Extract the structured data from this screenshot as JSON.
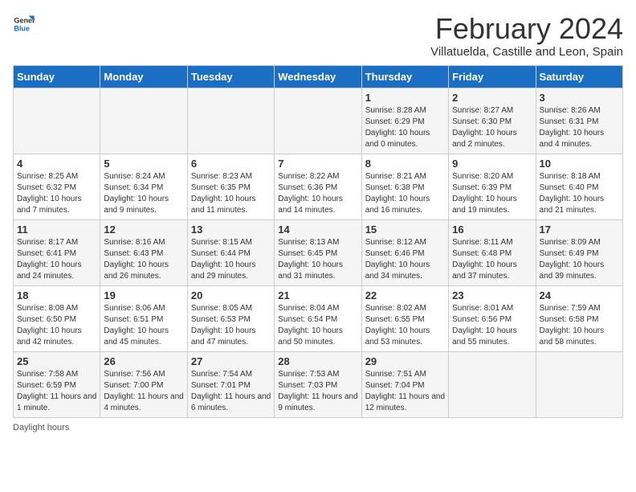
{
  "logo": {
    "general": "General",
    "blue": "Blue"
  },
  "title": "February 2024",
  "subtitle": "Villatuelda, Castille and Leon, Spain",
  "headers": [
    "Sunday",
    "Monday",
    "Tuesday",
    "Wednesday",
    "Thursday",
    "Friday",
    "Saturday"
  ],
  "weeks": [
    [
      {
        "day": "",
        "info": ""
      },
      {
        "day": "",
        "info": ""
      },
      {
        "day": "",
        "info": ""
      },
      {
        "day": "",
        "info": ""
      },
      {
        "day": "1",
        "info": "Sunrise: 8:28 AM\nSunset: 6:29 PM\nDaylight: 10 hours and 0 minutes."
      },
      {
        "day": "2",
        "info": "Sunrise: 8:27 AM\nSunset: 6:30 PM\nDaylight: 10 hours and 2 minutes."
      },
      {
        "day": "3",
        "info": "Sunrise: 8:26 AM\nSunset: 6:31 PM\nDaylight: 10 hours and 4 minutes."
      }
    ],
    [
      {
        "day": "4",
        "info": "Sunrise: 8:25 AM\nSunset: 6:32 PM\nDaylight: 10 hours and 7 minutes."
      },
      {
        "day": "5",
        "info": "Sunrise: 8:24 AM\nSunset: 6:34 PM\nDaylight: 10 hours and 9 minutes."
      },
      {
        "day": "6",
        "info": "Sunrise: 8:23 AM\nSunset: 6:35 PM\nDaylight: 10 hours and 11 minutes."
      },
      {
        "day": "7",
        "info": "Sunrise: 8:22 AM\nSunset: 6:36 PM\nDaylight: 10 hours and 14 minutes."
      },
      {
        "day": "8",
        "info": "Sunrise: 8:21 AM\nSunset: 6:38 PM\nDaylight: 10 hours and 16 minutes."
      },
      {
        "day": "9",
        "info": "Sunrise: 8:20 AM\nSunset: 6:39 PM\nDaylight: 10 hours and 19 minutes."
      },
      {
        "day": "10",
        "info": "Sunrise: 8:18 AM\nSunset: 6:40 PM\nDaylight: 10 hours and 21 minutes."
      }
    ],
    [
      {
        "day": "11",
        "info": "Sunrise: 8:17 AM\nSunset: 6:41 PM\nDaylight: 10 hours and 24 minutes."
      },
      {
        "day": "12",
        "info": "Sunrise: 8:16 AM\nSunset: 6:43 PM\nDaylight: 10 hours and 26 minutes."
      },
      {
        "day": "13",
        "info": "Sunrise: 8:15 AM\nSunset: 6:44 PM\nDaylight: 10 hours and 29 minutes."
      },
      {
        "day": "14",
        "info": "Sunrise: 8:13 AM\nSunset: 6:45 PM\nDaylight: 10 hours and 31 minutes."
      },
      {
        "day": "15",
        "info": "Sunrise: 8:12 AM\nSunset: 6:46 PM\nDaylight: 10 hours and 34 minutes."
      },
      {
        "day": "16",
        "info": "Sunrise: 8:11 AM\nSunset: 6:48 PM\nDaylight: 10 hours and 37 minutes."
      },
      {
        "day": "17",
        "info": "Sunrise: 8:09 AM\nSunset: 6:49 PM\nDaylight: 10 hours and 39 minutes."
      }
    ],
    [
      {
        "day": "18",
        "info": "Sunrise: 8:08 AM\nSunset: 6:50 PM\nDaylight: 10 hours and 42 minutes."
      },
      {
        "day": "19",
        "info": "Sunrise: 8:06 AM\nSunset: 6:51 PM\nDaylight: 10 hours and 45 minutes."
      },
      {
        "day": "20",
        "info": "Sunrise: 8:05 AM\nSunset: 6:53 PM\nDaylight: 10 hours and 47 minutes."
      },
      {
        "day": "21",
        "info": "Sunrise: 8:04 AM\nSunset: 6:54 PM\nDaylight: 10 hours and 50 minutes."
      },
      {
        "day": "22",
        "info": "Sunrise: 8:02 AM\nSunset: 6:55 PM\nDaylight: 10 hours and 53 minutes."
      },
      {
        "day": "23",
        "info": "Sunrise: 8:01 AM\nSunset: 6:56 PM\nDaylight: 10 hours and 55 minutes."
      },
      {
        "day": "24",
        "info": "Sunrise: 7:59 AM\nSunset: 6:58 PM\nDaylight: 10 hours and 58 minutes."
      }
    ],
    [
      {
        "day": "25",
        "info": "Sunrise: 7:58 AM\nSunset: 6:59 PM\nDaylight: 11 hours and 1 minute."
      },
      {
        "day": "26",
        "info": "Sunrise: 7:56 AM\nSunset: 7:00 PM\nDaylight: 11 hours and 4 minutes."
      },
      {
        "day": "27",
        "info": "Sunrise: 7:54 AM\nSunset: 7:01 PM\nDaylight: 11 hours and 6 minutes."
      },
      {
        "day": "28",
        "info": "Sunrise: 7:53 AM\nSunset: 7:03 PM\nDaylight: 11 hours and 9 minutes."
      },
      {
        "day": "29",
        "info": "Sunrise: 7:51 AM\nSunset: 7:04 PM\nDaylight: 11 hours and 12 minutes."
      },
      {
        "day": "",
        "info": ""
      },
      {
        "day": "",
        "info": ""
      }
    ]
  ],
  "footer": "Daylight hours"
}
